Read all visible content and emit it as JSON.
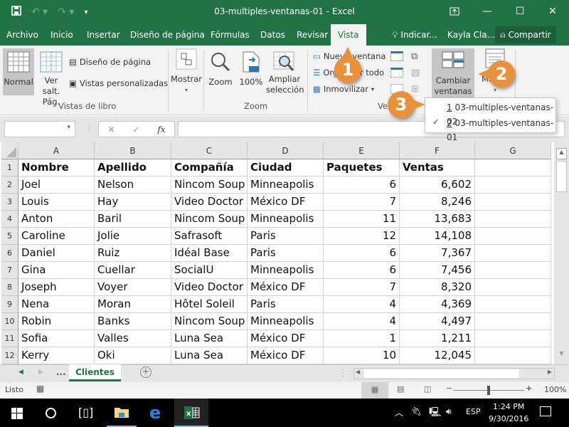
{
  "window": {
    "title": "03-multiples-ventanas-01 - Excel",
    "controls": {
      "ribbon_display": "ribbon-display-icon",
      "minimize": "minimize-icon",
      "maximize": "maximize-icon",
      "close": "close-icon"
    }
  },
  "qat": {
    "save": "save-icon",
    "undo": "undo-icon",
    "redo": "redo-icon",
    "customize": "customize-qat-icon"
  },
  "menu": {
    "tabs": [
      "Archivo",
      "Inicio",
      "Insertar",
      "Diseño de página",
      "Fórmulas",
      "Datos",
      "Revisar",
      "Vista"
    ],
    "active_tab": "Vista",
    "tell_me": "Indicar...",
    "user": "Kayla Cla...",
    "share": "Compartir"
  },
  "ribbon": {
    "vistas_de_libro": {
      "label": "Vistas de libro",
      "normal": "Normal",
      "ver_salt_1": "Ver salt.",
      "ver_salt_2": "Pág.",
      "diseno_pagina": "Diseño de página",
      "vistas_personalizadas": "Vistas personalizadas"
    },
    "mostrar": {
      "label": "Mostrar"
    },
    "zoom": {
      "label": "Zoom",
      "zoom": "Zoom",
      "cien": "100%",
      "ampliar_1": "Ampliar",
      "ampliar_2": "selección",
      "badge": "100"
    },
    "ventana": {
      "label": "Ve",
      "nueva_ventana": "Nueva ventana",
      "organizar_todo": "Organizar todo",
      "inmovilizar": "Inmovilizar",
      "cambiar_1": "Cambiar",
      "cambiar_2": "ventanas",
      "macros": "Ma"
    }
  },
  "window_menu": {
    "items": [
      {
        "accel": "1",
        "label": "03-multiples-ventanas-02",
        "checked": false
      },
      {
        "accel": "2",
        "label": "03-multiples-ventanas-01",
        "checked": true
      }
    ]
  },
  "callouts": [
    "1",
    "2",
    "3"
  ],
  "formula_bar": {
    "name_box": "",
    "formula": "",
    "fx": "fx"
  },
  "sheet": {
    "columns": [
      "A",
      "B",
      "C",
      "D",
      "E",
      "F",
      "G"
    ],
    "header_row": [
      "Nombre",
      "Apellido",
      "Compañía",
      "Ciudad",
      "Paquetes",
      "Ventas",
      ""
    ],
    "row_numbers": [
      "1",
      "2",
      "3",
      "4",
      "5",
      "6",
      "7",
      "8",
      "9",
      "10",
      "11",
      "12"
    ],
    "rows": [
      [
        "Joel",
        "Nelson",
        "Nincom Soup",
        "Minneapolis",
        "6",
        "6,602"
      ],
      [
        "Louis",
        "Hay",
        "Video Doctor",
        "México DF",
        "7",
        "8,246"
      ],
      [
        "Anton",
        "Baril",
        "Nincom Soup",
        "Minneapolis",
        "11",
        "13,683"
      ],
      [
        "Caroline",
        "Jolie",
        "Safrasoft",
        "Paris",
        "12",
        "14,108"
      ],
      [
        "Daniel",
        "Ruiz",
        "Idéal Base",
        "Paris",
        "6",
        "7,367"
      ],
      [
        "Gina",
        "Cuellar",
        "SocialU",
        "Minneapolis",
        "6",
        "7,456"
      ],
      [
        "Joseph",
        "Voyer",
        "Video Doctor",
        "México DF",
        "7",
        "8,320"
      ],
      [
        "Nena",
        "Moran",
        "Hôtel Soleil",
        "Paris",
        "4",
        "4,369"
      ],
      [
        "Robin",
        "Banks",
        "Nincom Soup",
        "Minneapolis",
        "4",
        "4,497"
      ],
      [
        "Sofia",
        "Valles",
        "Luna Sea",
        "México DF",
        "1",
        "1,211"
      ],
      [
        "Kerry",
        "Oki",
        "Luna Sea",
        "México DF",
        "10",
        "12,045"
      ]
    ]
  },
  "sheet_tabs": {
    "ellipsis": "...",
    "active": "Clientes"
  },
  "status": {
    "text": "Listo",
    "zoom": "100%",
    "zoom_level": 100
  },
  "taskbar": {
    "lang": "ESP",
    "time": "1:24 PM",
    "date": "9/30/2016"
  },
  "colors": {
    "brand": "#217346",
    "callout": "#e8913a"
  }
}
